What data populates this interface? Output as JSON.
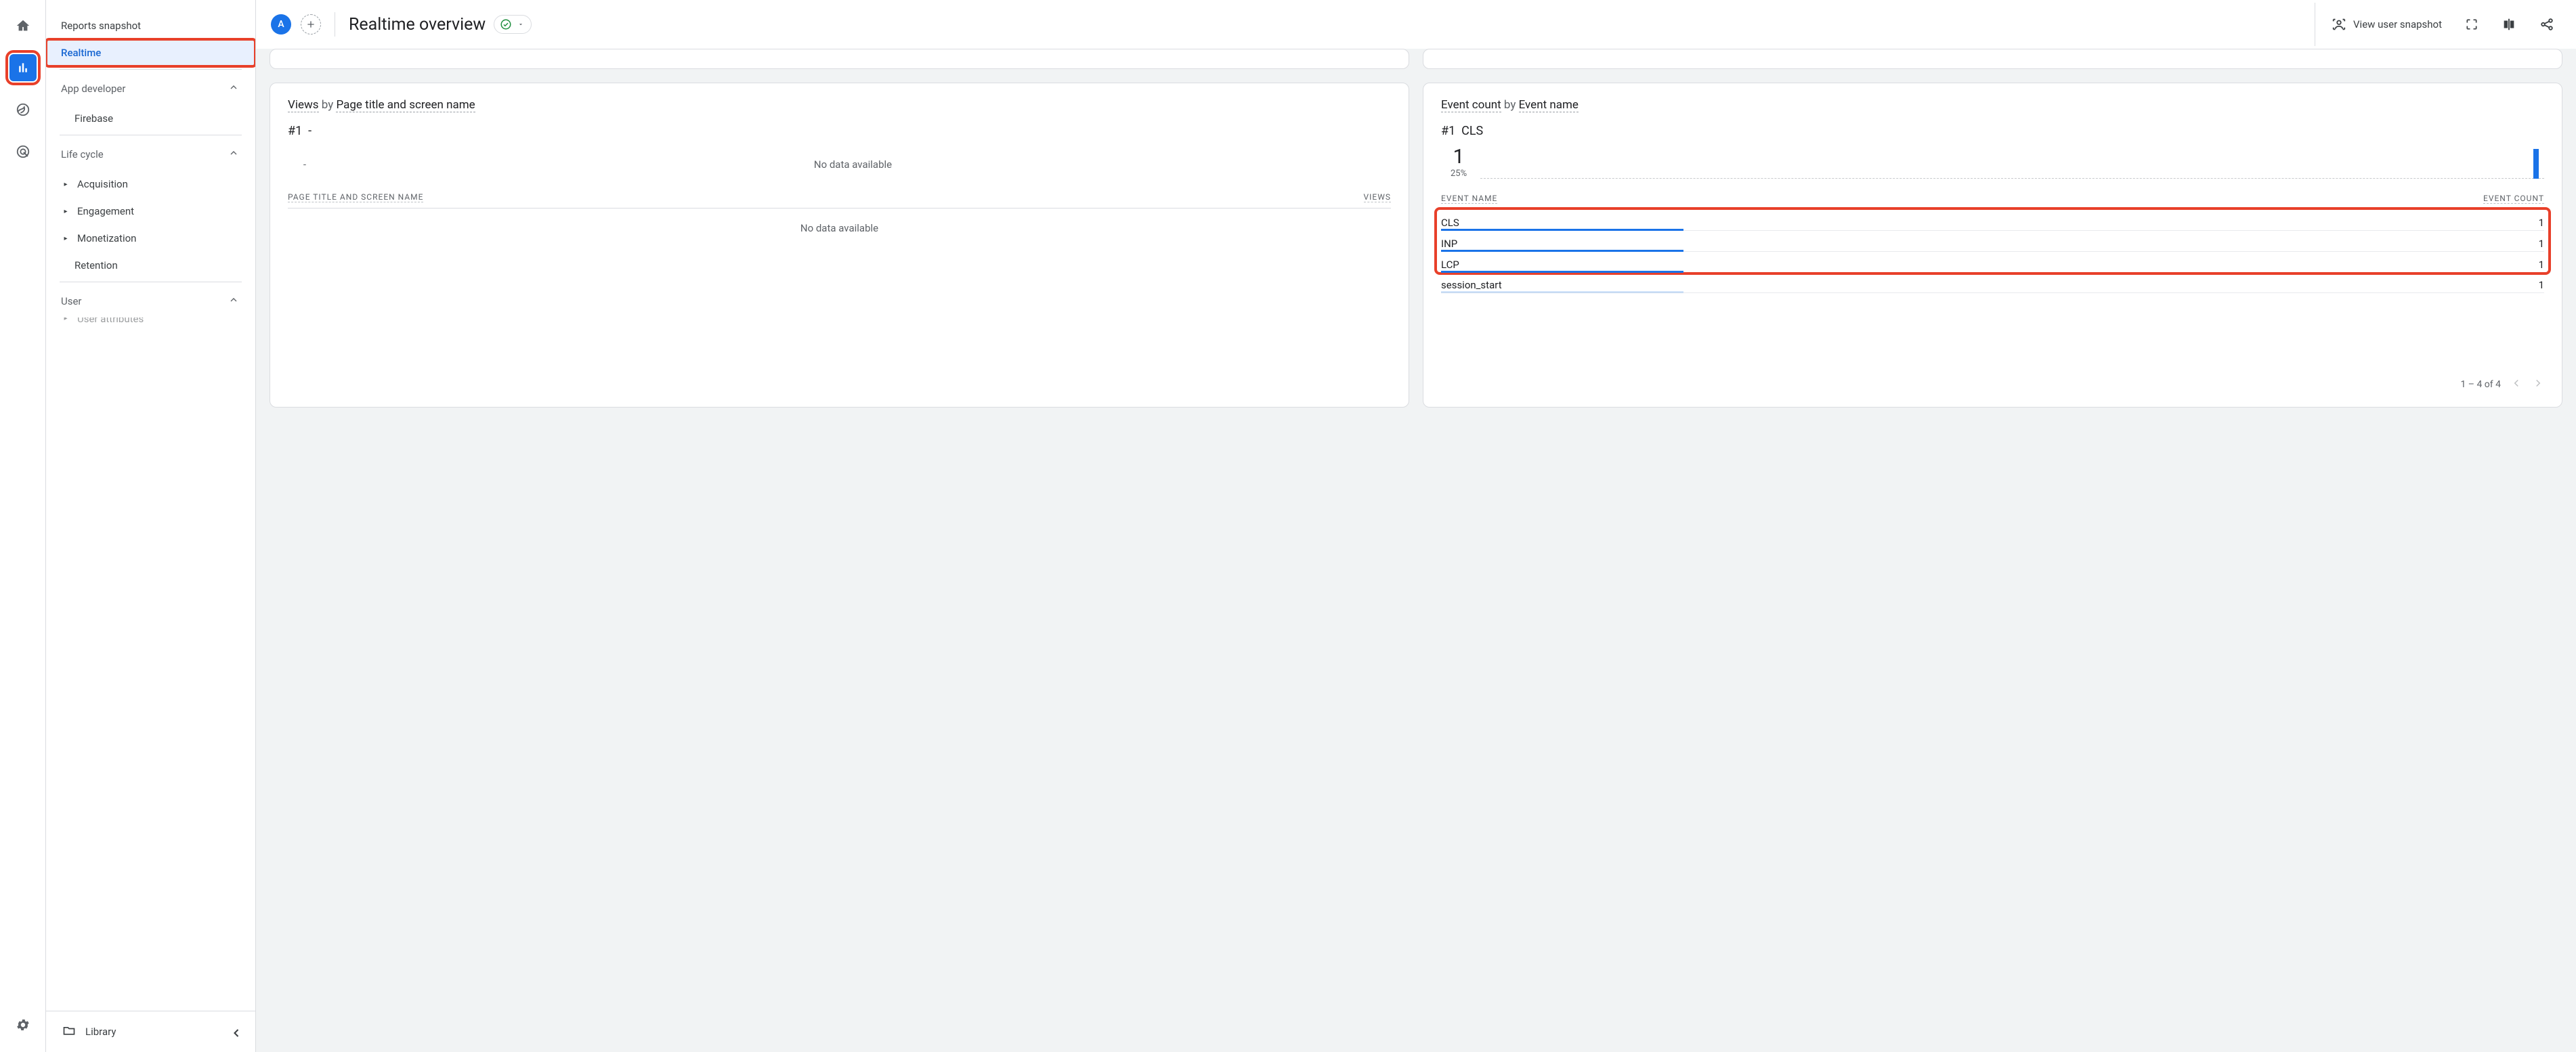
{
  "sidebar": {
    "reports_snapshot": "Reports snapshot",
    "realtime": "Realtime",
    "app_developer": "App developer",
    "firebase": "Firebase",
    "life_cycle": "Life cycle",
    "acquisition": "Acquisition",
    "engagement": "Engagement",
    "monetization": "Monetization",
    "retention": "Retention",
    "user": "User",
    "user_attributes": "User attributes",
    "library": "Library"
  },
  "topbar": {
    "chip_a": "A",
    "title": "Realtime overview",
    "view_user_snapshot": "View user snapshot"
  },
  "cards": {
    "views": {
      "metric": "Views",
      "by": "by",
      "dimension": "Page title and screen name",
      "rank": "#1",
      "rank_label": "-",
      "no_data_top": "No data available",
      "col_left": "PAGE TITLE AND SCREEN NAME",
      "col_right": "VIEWS",
      "no_data_table": "No data available"
    },
    "events": {
      "metric": "Event count",
      "by": "by",
      "dimension": "Event name",
      "rank": "#1",
      "rank_label": "CLS",
      "kpi": "1",
      "kpi_sub": "25%",
      "col_left": "EVENT NAME",
      "col_right": "EVENT COUNT",
      "rows": [
        {
          "name": "CLS",
          "count": "1"
        },
        {
          "name": "INP",
          "count": "1"
        },
        {
          "name": "LCP",
          "count": "1"
        },
        {
          "name": "session_start",
          "count": "1"
        }
      ],
      "pager": "1 – 4 of 4"
    }
  }
}
